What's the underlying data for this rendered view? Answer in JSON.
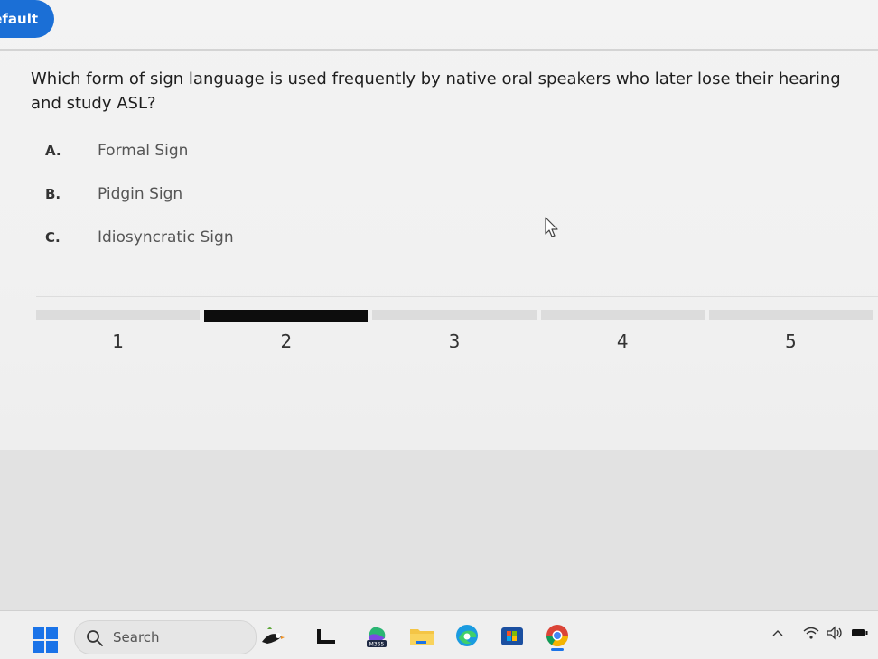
{
  "header": {
    "tab_label": "efault"
  },
  "question": {
    "text": "Which form of sign language is used frequently by native oral speakers who later lose their hearing and study ASL?",
    "options": [
      {
        "letter": "A.",
        "text": "Formal Sign"
      },
      {
        "letter": "B.",
        "text": "Pidgin Sign"
      },
      {
        "letter": "C.",
        "text": "Idiosyncratic Sign"
      }
    ]
  },
  "pagination": {
    "steps": [
      "1",
      "2",
      "3",
      "4",
      "5"
    ],
    "current_step": "2"
  },
  "taskbar": {
    "search_placeholder": "Search",
    "m365_label": "M365",
    "apps": [
      "start-icon",
      "search-icon",
      "puffin-icon",
      "terminal-icon",
      "copilot-m365-icon",
      "file-explorer-icon",
      "edge-icon",
      "store-icon",
      "chrome-icon"
    ],
    "tray": [
      "chevron-up-icon",
      "wifi-icon",
      "volume-icon",
      "battery-icon"
    ]
  },
  "colors": {
    "accent": "#1b6fd6",
    "progress_active": "#0d0d0d",
    "progress_inactive": "#dcdcdc"
  }
}
